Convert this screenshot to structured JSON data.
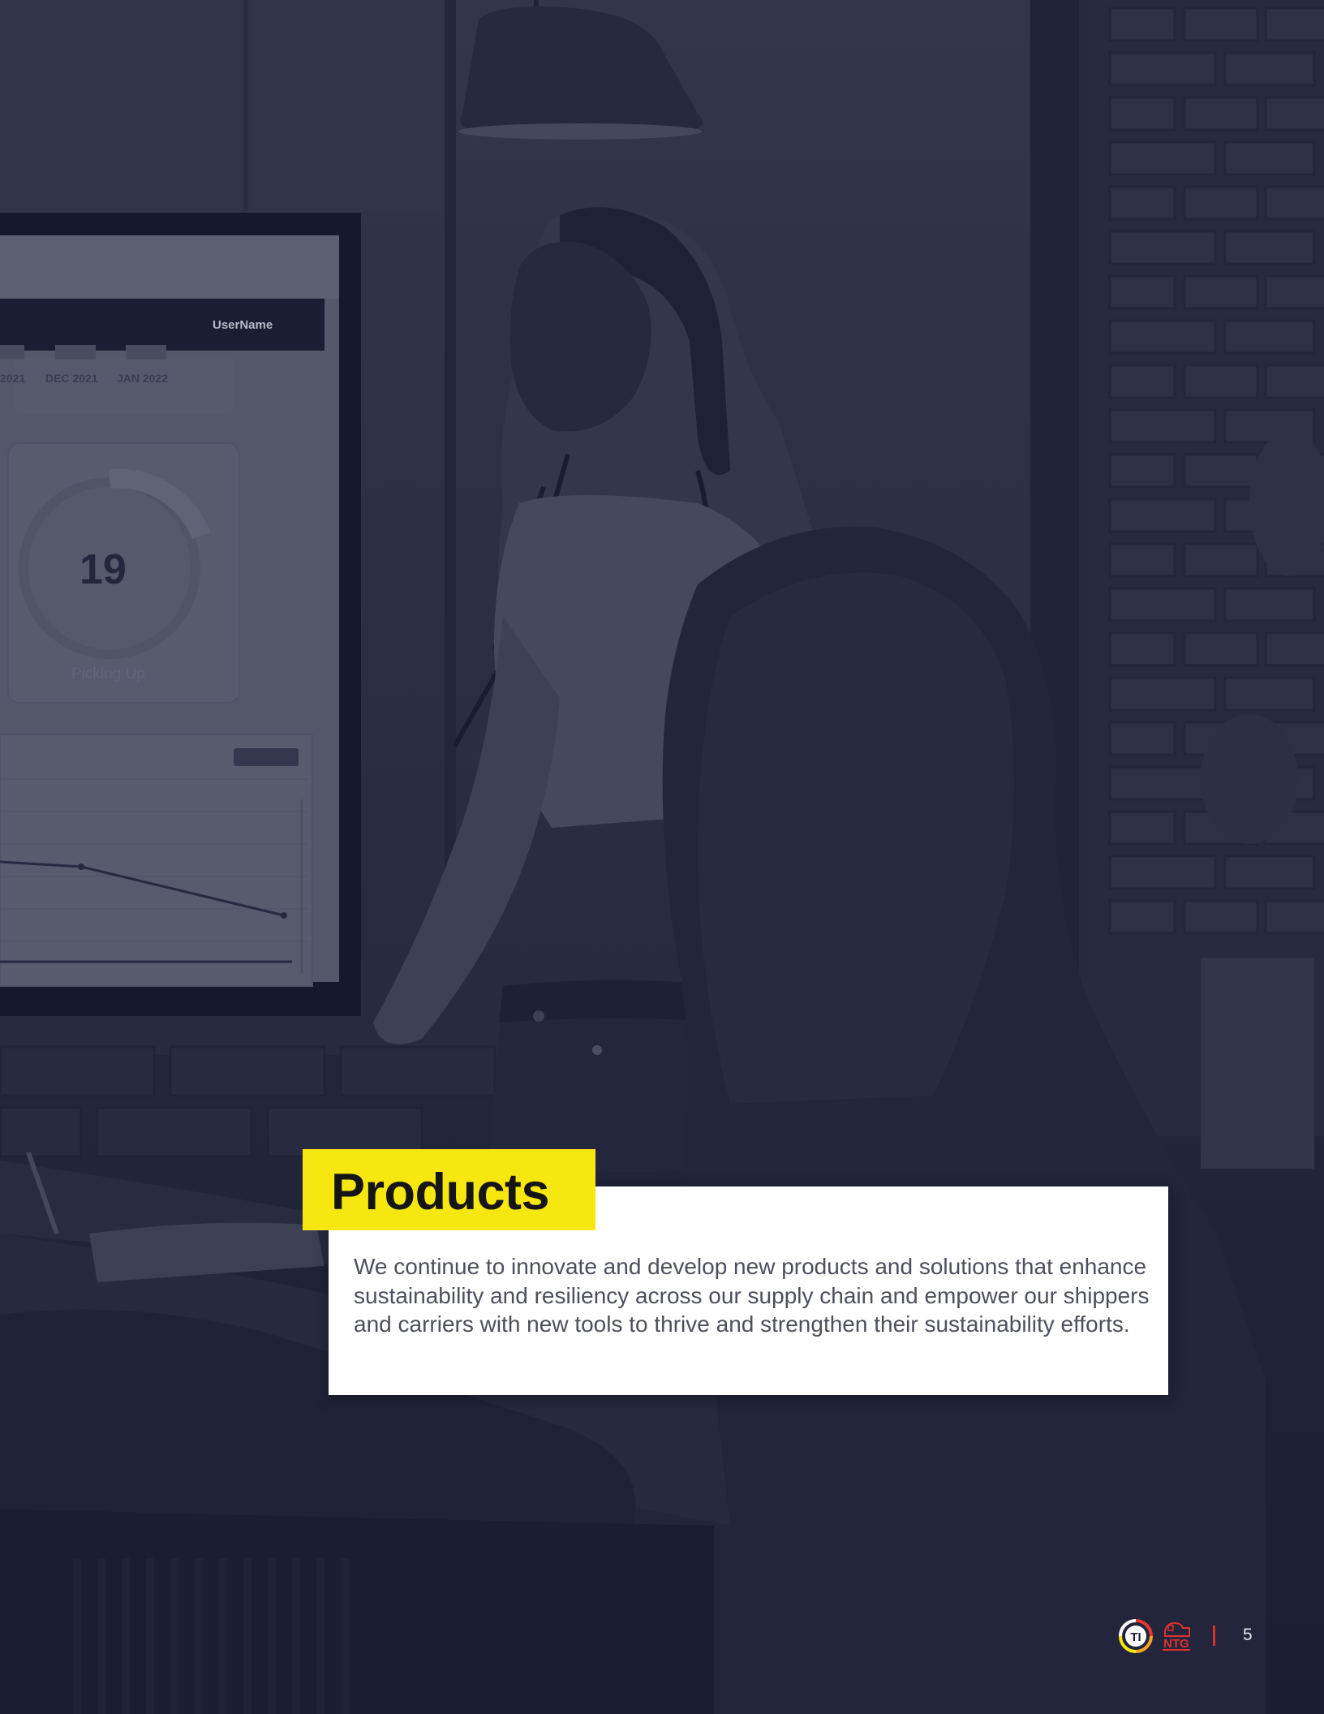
{
  "page": {
    "overlay_color": "#1d2037",
    "accent_color": "#f7e710"
  },
  "screen": {
    "username": "UserName",
    "months": [
      "2021",
      "DEC 2021",
      "JAN 2022"
    ],
    "big_number": "19",
    "caption": "Picking Up"
  },
  "section": {
    "title": "Products",
    "body": "We continue to innovate and develop new products and solutions that enhance sustainability and resiliency across our supply chain and empower our shippers and carriers with new tools to thrive and strengthen their sustainability efforts."
  },
  "footer": {
    "logo_ti": "TI",
    "logo_ntg": "NTG",
    "divider_color": "#e0302b",
    "page_number": "5"
  }
}
